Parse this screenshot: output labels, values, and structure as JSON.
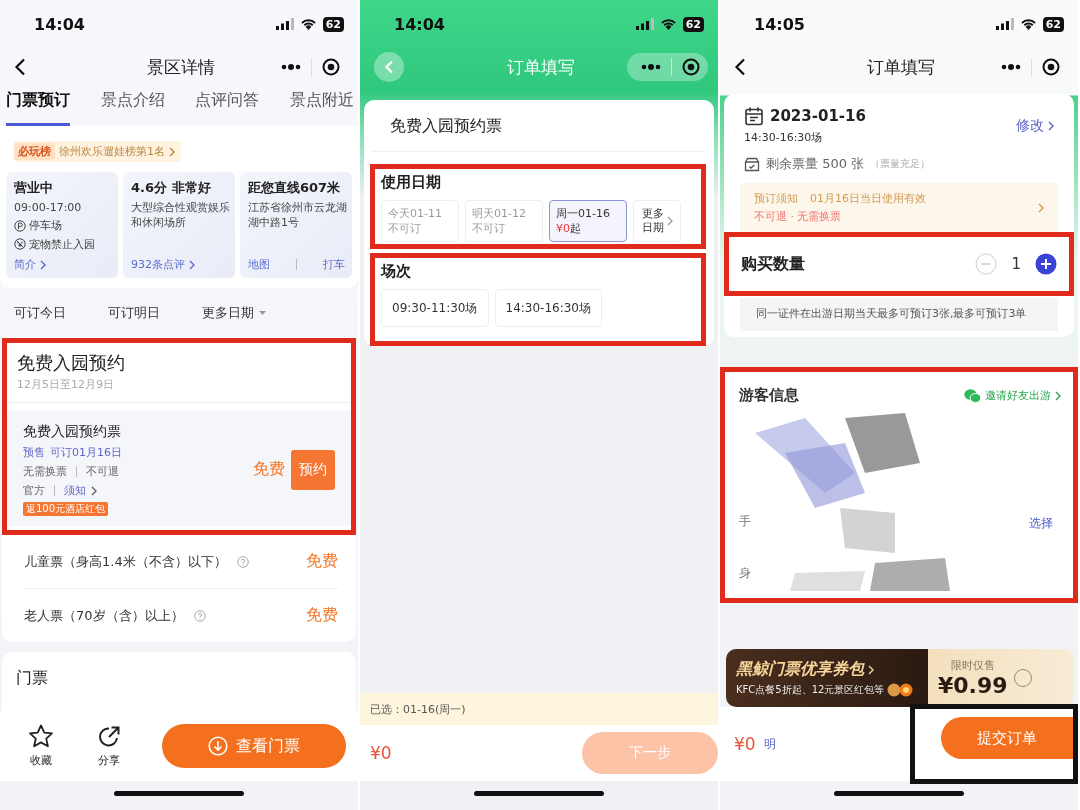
{
  "scenic_detail": {
    "status_bar": {
      "time": "14:04",
      "battery": "62"
    },
    "title": "景区详情",
    "tabs": [
      {
        "label": "门票预订",
        "selected": true
      },
      {
        "label": "景点介绍",
        "selected": false
      },
      {
        "label": "点评问答",
        "selected": false
      },
      {
        "label": "景点附近",
        "selected": false
      }
    ],
    "ranking": {
      "tag": "必玩榜",
      "text": "徐州欢乐遛娃榜第1名"
    },
    "info_cards": [
      {
        "title": "营业中",
        "lines": [
          "09:00-17:00",
          "停车场",
          "宠物禁止入园"
        ],
        "links": [
          "简介"
        ]
      },
      {
        "title": "4.6分 非常好",
        "lines": [
          "大型综合性观赏娱乐和休闲场所"
        ],
        "links": [
          "932条点评"
        ]
      },
      {
        "title": "距您直线607米",
        "lines": [
          "江苏省徐州市云龙湖湖中路1号"
        ],
        "links": [
          "地图",
          "打车"
        ]
      }
    ],
    "date_filters": [
      {
        "label": "可订今日",
        "dropdown": false
      },
      {
        "label": "可订明日",
        "dropdown": false
      },
      {
        "label": "更多日期",
        "dropdown": true
      }
    ],
    "booking": {
      "highlighted": true,
      "title": "免费入园预约",
      "period": "12月5日至12月9日",
      "ticket": {
        "name": "免费入园预约票",
        "sale_tag": "预售",
        "availability": "可订01月16日",
        "terms": [
          "无需换票",
          "不可退"
        ],
        "source": "官方",
        "notice_link": "须知",
        "promo": "返100元酒店红包",
        "price": "免费",
        "button": "预约"
      }
    },
    "other_tickets": [
      {
        "name": "儿童票（身高1.4米（不含）以下）",
        "price": "免费"
      },
      {
        "name": "老人票（70岁（含）以上）",
        "price": "免费"
      }
    ],
    "next_section": "门票",
    "bottom_bar": {
      "actions": [
        "收藏",
        "分享"
      ],
      "button": "查看门票"
    }
  },
  "order_date_step": {
    "status_bar": {
      "time": "14:04",
      "battery": "62"
    },
    "title": "订单填写",
    "ticket_name": "免费入园预约票",
    "date_section": {
      "highlighted": true,
      "label": "使用日期",
      "dates": [
        {
          "day": "今天01-11",
          "note": "不可订",
          "disabled": true,
          "selected": false
        },
        {
          "day": "明天01-12",
          "note": "不可订",
          "disabled": true,
          "selected": false
        },
        {
          "day": "周一01-16",
          "price": "¥0",
          "note": "起",
          "disabled": false,
          "selected": true
        }
      ],
      "more": "更多日期"
    },
    "session_section": {
      "highlighted": true,
      "label": "场次",
      "sessions": [
        {
          "label": "09:30-11:30场",
          "selected": false
        },
        {
          "label": "14:30-16:30场",
          "selected": false
        }
      ]
    },
    "selection": "已选：01-16(周一)",
    "footer": {
      "price": "¥0",
      "button": "下一步",
      "disabled": true
    }
  },
  "order_confirm_step": {
    "status_bar": {
      "time": "14:05",
      "battery": "62"
    },
    "title": "订单填写",
    "visit": {
      "date": "2023-01-16",
      "session": "14:30-16:30场",
      "edit_link": "修改",
      "stock": "剩余票量 500 张",
      "stock_note": "（票量充足）"
    },
    "notice": {
      "label": "预订须知",
      "validity": "01月16日当日使用有效",
      "terms": "不可退 · 无需换票"
    },
    "quantity": {
      "highlighted": true,
      "label": "购买数量",
      "value": "1",
      "minus_disabled": true
    },
    "limit_note": "同一证件在出游日期当天最多可预订3张,最多可预订3单",
    "visitors": {
      "highlighted": true,
      "label": "游客信息",
      "invite": "邀请好友出游",
      "redacted": true,
      "fields": [
        "手",
        "身"
      ],
      "select_link": "选择"
    },
    "promo": {
      "title": "黑鲸门票优享券包",
      "subtitle": "KFC点餐5折起、12元景区红包等",
      "tag": "限时仅售",
      "price": "¥0.99",
      "checked": false
    },
    "footer": {
      "price": "¥0",
      "details": "明",
      "button": "提交订单",
      "highlighted": true
    }
  }
}
